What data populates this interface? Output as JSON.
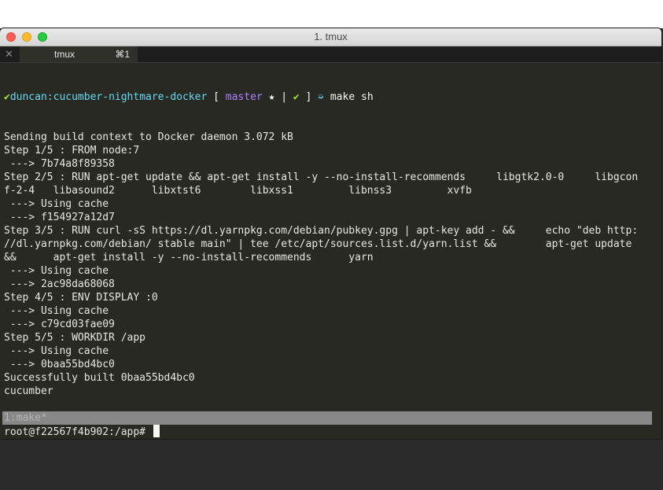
{
  "window": {
    "title": "1. tmux"
  },
  "tabbar": {
    "close_glyph": "✕",
    "tab_name": "tmux",
    "tab_shortcut": "⌘1"
  },
  "prompt": {
    "check": "✔",
    "user": "duncan",
    "sep": ":",
    "dir": "cucumber-nightmare-docker",
    "open_bracket": " [ ",
    "branch": "master",
    "star_bar": " ★ | ",
    "check2": "✔",
    "close_bracket": " ] ",
    "arrow": "➭",
    "command": " make sh"
  },
  "output_lines": [
    "Sending build context to Docker daemon 3.072 kB",
    "Step 1/5 : FROM node:7",
    " ---> 7b74a8f89358",
    "Step 2/5 : RUN apt-get update && apt-get install -y --no-install-recommends     libgtk2.0-0     libgcon",
    "f-2-4   libasound2      libxtst6        libxss1         libnss3         xvfb",
    " ---> Using cache",
    " ---> f154927a12d7",
    "Step 3/5 : RUN curl -sS https://dl.yarnpkg.com/debian/pubkey.gpg | apt-key add - &&     echo \"deb http:",
    "//dl.yarnpkg.com/debian/ stable main\" | tee /etc/apt/sources.list.d/yarn.list &&        apt-get update",
    "&&      apt-get install -y --no-install-recommends      yarn",
    " ---> Using cache",
    " ---> 2ac98da68068",
    "Step 4/5 : ENV DISPLAY :0",
    " ---> Using cache",
    " ---> c79cd03fae09",
    "Step 5/5 : WORKDIR /app",
    " ---> Using cache",
    " ---> 0baa55bd4bc0",
    "Successfully built 0baa55bd4bc0",
    "cucumber"
  ],
  "shell_prompt": "root@f22567f4b902:/app# ",
  "statusbar": {
    "text": "1:make*"
  }
}
